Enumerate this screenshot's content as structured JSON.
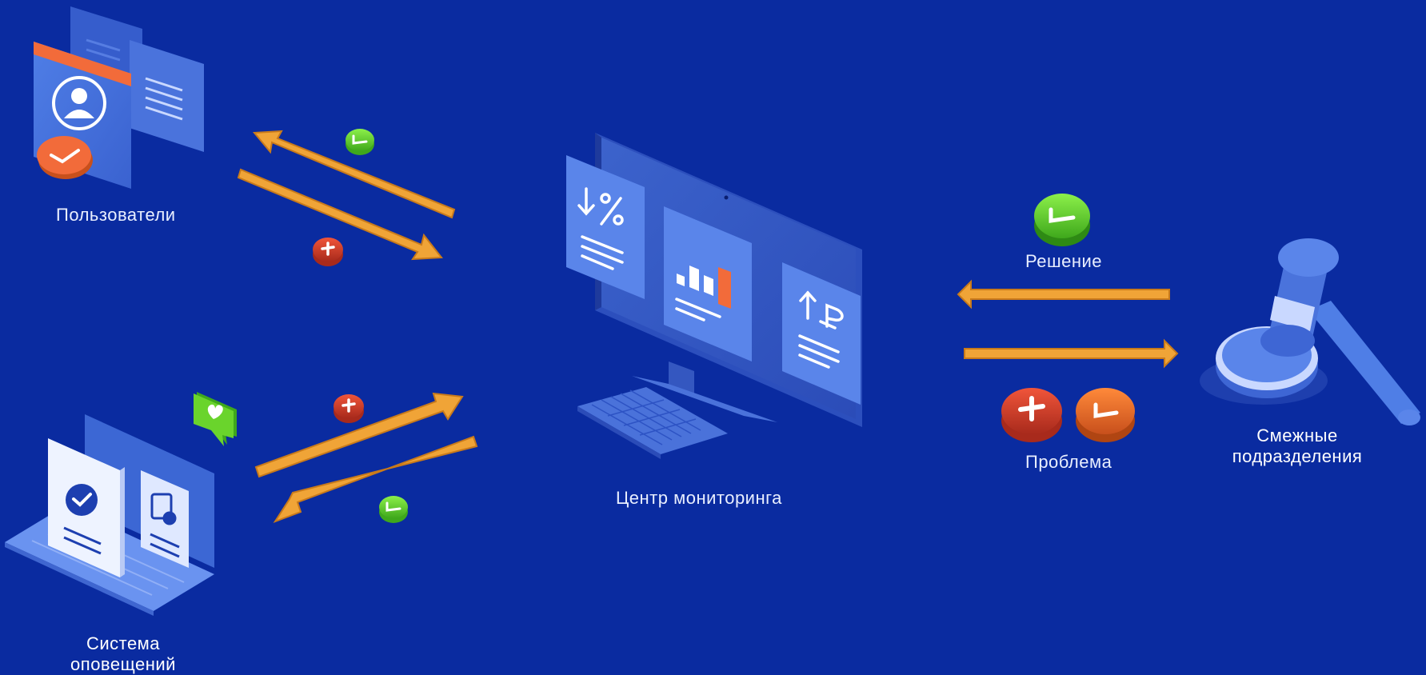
{
  "labels": {
    "users": "Пользователи",
    "monitoring_center": "Центр мониторинга",
    "notifications_line1": "Система",
    "notifications_line2": "оповещений",
    "related_line1": "Смежные",
    "related_line2": "подразделения",
    "solution": "Решение",
    "problem": "Проблема"
  },
  "icons": {
    "plus": "plus-icon",
    "check": "check-icon",
    "heart_message": "heart-message-icon",
    "percent_down": "percent-down-icon",
    "ruble_up": "ruble-up-icon",
    "bar_chart": "bar-chart-icon",
    "gavel": "gavel-icon",
    "user": "user-icon"
  },
  "colors": {
    "background": "#0a2ba0",
    "arrow": "#f0a437",
    "badge_green": "#5fd02a",
    "badge_red": "#d6402a",
    "badge_orange": "#f06b2a",
    "accent_orange": "#f26b3a"
  }
}
